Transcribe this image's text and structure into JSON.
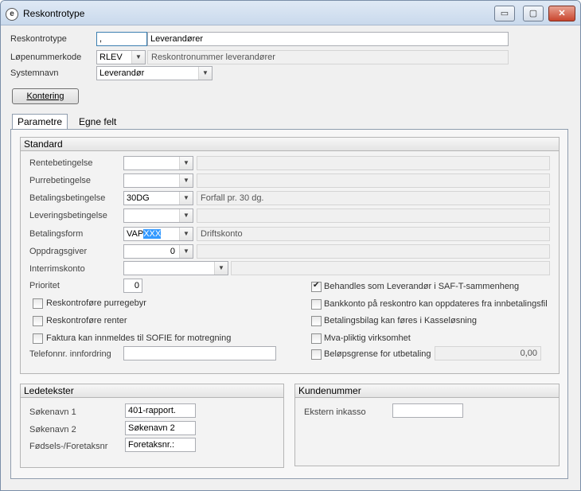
{
  "window": {
    "title": "Reskontrotype",
    "buttons": {
      "minimize": "▭",
      "maximize": "▢",
      "close": "✕"
    }
  },
  "header": {
    "reskontrotype_label": "Reskontrotype",
    "reskontrotype_code": ",",
    "reskontrotype_name": "Leverandører",
    "lopenummer_label": "Løpenummerkode",
    "lopenummer_value": "RLEV",
    "lopenummer_desc": "Reskontronummer leverandører",
    "systemnavn_label": "Systemnavn",
    "systemnavn_value": "Leverandør",
    "kontering_button": "Kontering"
  },
  "tabs": [
    {
      "label": "Parametre",
      "active": true
    },
    {
      "label": "Egne felt",
      "active": false
    }
  ],
  "standard": {
    "title": "Standard",
    "rows": {
      "rentebetingelse": {
        "label": "Rentebetingelse",
        "value": "",
        "desc": ""
      },
      "purrebetingelse": {
        "label": "Purrebetingelse",
        "value": "",
        "desc": ""
      },
      "betalingsbetingelse": {
        "label": "Betalingsbetingelse",
        "value": "30DG",
        "desc": "Forfall pr. 30 dg."
      },
      "leveringsbetingelse": {
        "label": "Leveringsbetingelse",
        "value": "",
        "desc": ""
      },
      "betalingsform": {
        "label": "Betalingsform",
        "value_plain": "VAP",
        "value_selected": "XXX",
        "desc": "Driftskonto"
      },
      "oppdragsgiver": {
        "label": "Oppdragsgiver",
        "value": "0",
        "desc": ""
      },
      "interrimskonto": {
        "label": "Interrimskonto",
        "value": "",
        "desc": ""
      }
    },
    "prioritet": {
      "label": "Prioritet",
      "value": "0"
    },
    "checkboxes_left": [
      {
        "label": "Reskontroføre purregebyr",
        "checked": false
      },
      {
        "label": "Reskontroføre renter",
        "checked": false
      },
      {
        "label": "Faktura kan innmeldes til SOFIE for motregning",
        "checked": false
      }
    ],
    "checkboxes_right": [
      {
        "label": "Behandles som Leverandør i SAF-T-sammenheng",
        "checked": true
      },
      {
        "label": "Bankkonto på reskontro kan oppdateres fra innbetalingsfil",
        "checked": false
      },
      {
        "label": "Betalingsbilag kan føres i Kasseløsning",
        "checked": false
      },
      {
        "label": "Mva-pliktig virksomhet",
        "checked": false
      },
      {
        "label": "Beløpsgrense for utbetaling",
        "checked": false
      }
    ],
    "belopsgrense_value": "0,00",
    "telefon": {
      "label": "Telefonnr. innfordring",
      "value": ""
    }
  },
  "ledetekster": {
    "title": "Ledetekster",
    "fields": [
      {
        "label": "Søkenavn 1",
        "value": "401-rapport."
      },
      {
        "label": "Søkenavn 2",
        "value": "Søkenavn 2"
      },
      {
        "label": "Fødsels-/Foretaksnr",
        "value": "Foretaksnr.:"
      }
    ]
  },
  "kundenummer": {
    "title": "Kundenummer",
    "ekstern_label": "Ekstern inkasso",
    "ekstern_value": ""
  }
}
